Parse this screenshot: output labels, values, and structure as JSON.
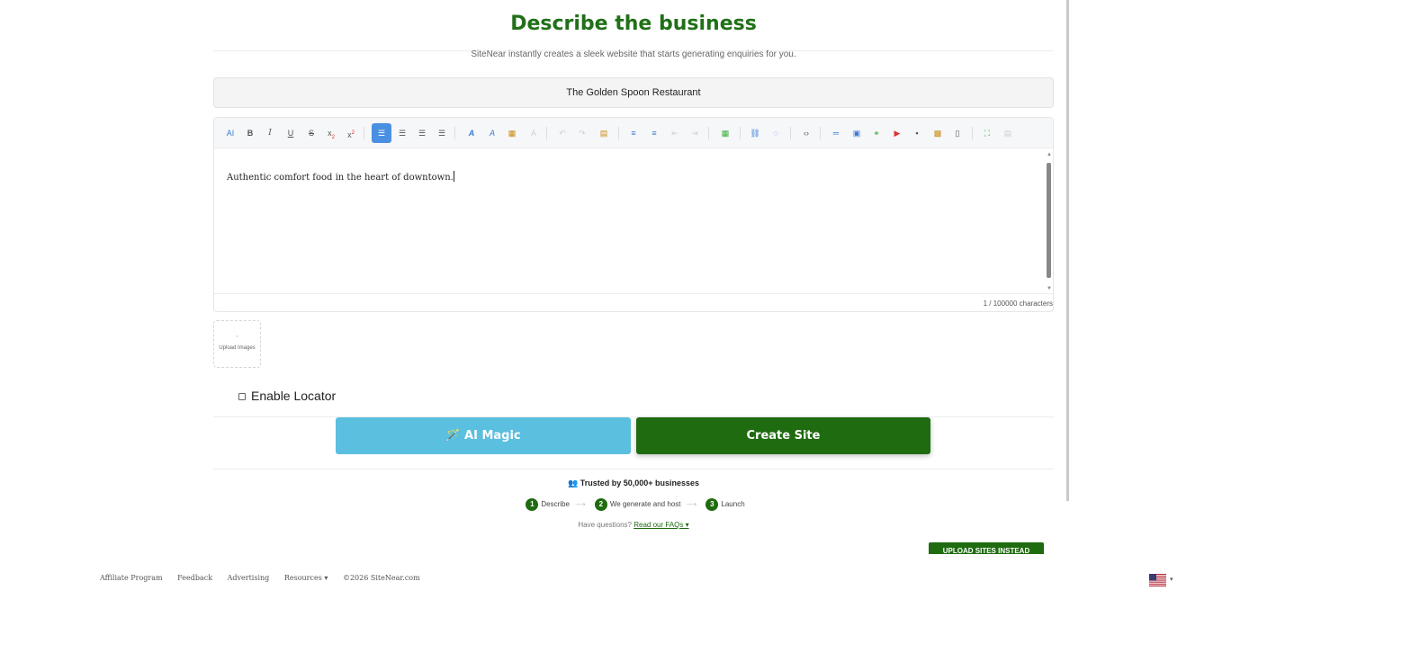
{
  "page": {
    "title": "Describe the business",
    "subtitle": "SiteNear instantly creates a sleek website that starts generating enquiries for you."
  },
  "form": {
    "business_name": "The Golden Spoon Restaurant",
    "description": "Authentic comfort food in the heart of downtown.",
    "char_counter": "1 / 100000 characters",
    "upload_label": "Upload Images",
    "enable_locator_label": "Enable Locator",
    "enable_locator_checked": false
  },
  "toolbar": {
    "tools": [
      "ai",
      "bold",
      "italic",
      "underline",
      "strikethrough",
      "subscript",
      "superscript",
      "align-left",
      "align-center",
      "align-right",
      "align-justify",
      "font-color",
      "highlight",
      "table-style",
      "clear-format",
      "undo",
      "redo",
      "paste",
      "bulleted-list",
      "numbered-list",
      "outdent",
      "indent",
      "table",
      "link",
      "comment",
      "source-code",
      "horizontal-rule",
      "image",
      "link-image",
      "youtube",
      "embed",
      "gallery",
      "template",
      "fullscreen",
      "preview"
    ],
    "active": "align-left"
  },
  "buttons": {
    "ai_magic": "🪄 AI Magic",
    "create_site": "Create Site",
    "upload_sites": "UPLOAD SITES INSTEAD"
  },
  "info": {
    "trusted": "👥 Trusted by 50,000+ businesses",
    "steps": [
      "Describe",
      "We generate and host",
      "Launch"
    ],
    "step_numbers": [
      "1",
      "2",
      "3"
    ],
    "step_arrow": "⟶",
    "faq_prefix": "Have questions? ",
    "faq_link": "Read our FAQs ▾"
  },
  "footer": {
    "links": [
      "Affiliate Program",
      "Feedback",
      "Advertising",
      "Resources ▾",
      "©2026 SiteNear.com"
    ],
    "language_caret": "▾"
  },
  "colors": {
    "brand_green": "#1f6b10",
    "title_green": "#217018",
    "ai_blue": "#5bbfdf",
    "toolbar_active": "#4a90e2"
  }
}
